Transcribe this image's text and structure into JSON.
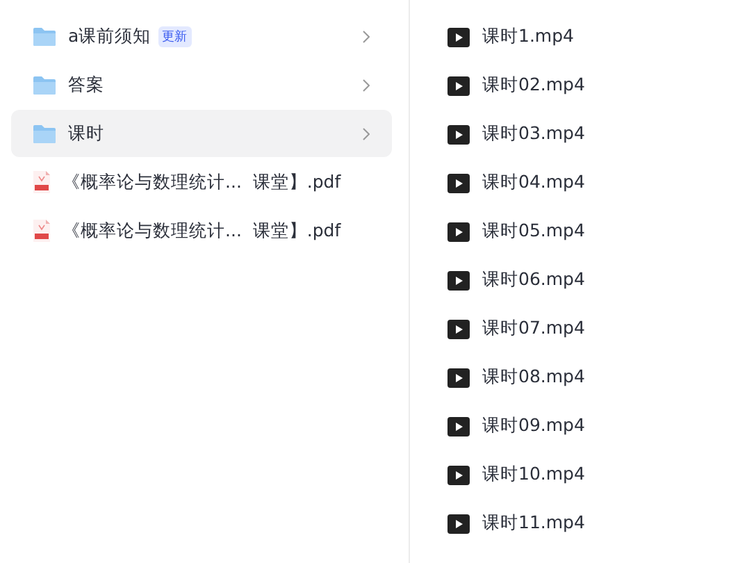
{
  "folder_list": {
    "items": [
      {
        "kind": "folder",
        "name": "a课前须知",
        "badge": "更新",
        "selected": false
      },
      {
        "kind": "folder",
        "name": "答案",
        "selected": false
      },
      {
        "kind": "folder",
        "name": "课时",
        "selected": true
      },
      {
        "kind": "pdf",
        "name": "《概率论与数理统计...  课堂】.pdf",
        "selected": false
      },
      {
        "kind": "pdf",
        "name": "《概率论与数理统计...  课堂】.pdf",
        "selected": false
      }
    ]
  },
  "file_list": {
    "items": [
      {
        "kind": "video",
        "name": "课时1.mp4"
      },
      {
        "kind": "video",
        "name": "课时02.mp4"
      },
      {
        "kind": "video",
        "name": "课时03.mp4"
      },
      {
        "kind": "video",
        "name": "课时04.mp4"
      },
      {
        "kind": "video",
        "name": "课时05.mp4"
      },
      {
        "kind": "video",
        "name": "课时06.mp4"
      },
      {
        "kind": "video",
        "name": "课时07.mp4"
      },
      {
        "kind": "video",
        "name": "课时08.mp4"
      },
      {
        "kind": "video",
        "name": "课时09.mp4"
      },
      {
        "kind": "video",
        "name": "课时10.mp4"
      },
      {
        "kind": "video",
        "name": "课时11.mp4"
      }
    ]
  }
}
